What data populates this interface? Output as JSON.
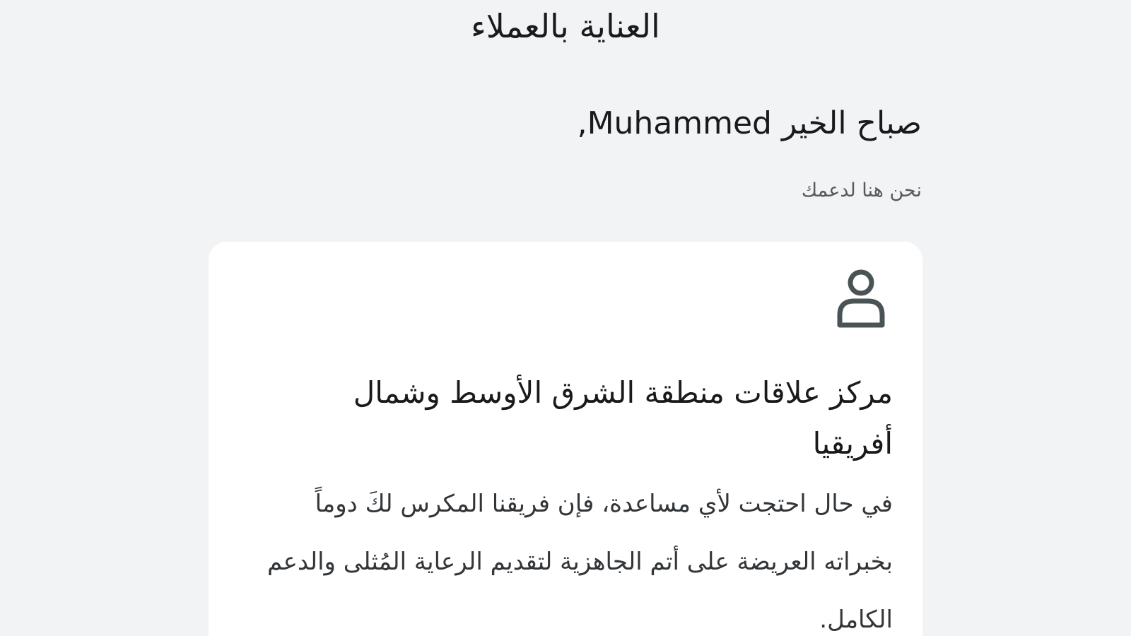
{
  "header": {
    "title": "العناية بالعملاء"
  },
  "greeting": {
    "text": "صباح الخير Muhammed,",
    "subtitle": "نحن هنا لدعمك"
  },
  "support_card": {
    "icon": "person-icon",
    "title": "مركز علاقات منطقة الشرق الأوسط وشمال أفريقيا",
    "body": "في حال احتجت لأي مساعدة، فإن فريقنا المكرس لكَ دوماً بخبراته العريضة على أتم الجاهزية لتقديم الرعاية المُثلى والدعم الكامل."
  },
  "colors": {
    "background": "#f1f3f5",
    "card": "#ffffff",
    "icon": "#4a5355"
  }
}
